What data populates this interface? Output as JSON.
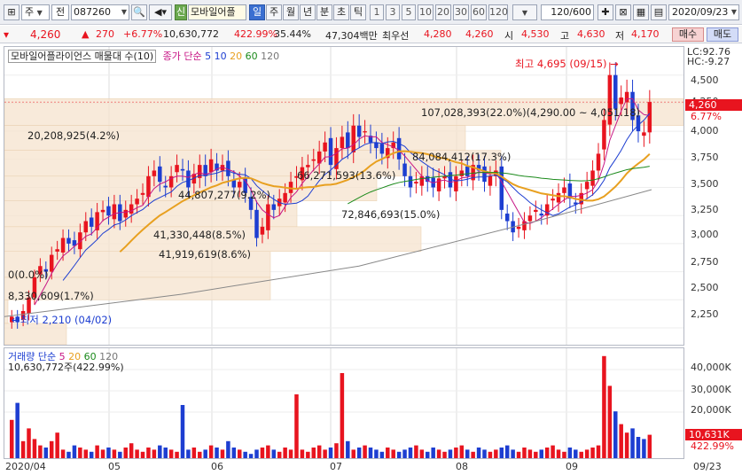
{
  "toolbar": {
    "type_select": "주",
    "market_select": "전",
    "stock_code": "087260",
    "credit_badge": "신",
    "stock_name": "모바일어플",
    "periods": [
      "일",
      "주",
      "월",
      "년",
      "분",
      "초",
      "틱"
    ],
    "selected_period": "일",
    "intervals": [
      "1",
      "3",
      "5",
      "10",
      "20",
      "30",
      "60",
      "120"
    ],
    "count_display": "120",
    "count_total": "/600",
    "date_value": "2020/09/23"
  },
  "quote": {
    "price": "4,260",
    "change": "270",
    "change_rate": "+6.77%",
    "volume": "10,630,772",
    "volume_rate": "422.99%",
    "turnover": "35.44%",
    "amount": "47,304백만",
    "best_ask_label": "최우선",
    "best_ask": "4,280",
    "best_bid": "4,260",
    "open_label": "시",
    "open": "4,530",
    "high_label": "고",
    "high": "4,630",
    "low_label": "저",
    "low": "4,170",
    "buy_button": "매수",
    "sell_button": "매도"
  },
  "chart": {
    "title": "모바일어플라이언스 매물대 수(10)",
    "legend_main": {
      "close_label": "종가 단순",
      "ma": [
        "5",
        "10",
        "20",
        "60",
        "120"
      ],
      "colors": [
        "#1d3ed1",
        "#e8a020",
        "#1b8a1b",
        "#777777"
      ]
    },
    "legend_volume": {
      "label": "거래량 단순",
      "ma": [
        "5",
        "20",
        "60",
        "120"
      ]
    },
    "volume_value": "10,630,772주(422.99%)",
    "lc": "LC:92.76",
    "hc": "HC:-9.27",
    "high_marker": "최고 4,695 (09/15)",
    "low_marker": "최저 2,210 (04/02)",
    "price_tag": "4,260",
    "rate_tag": "6.77%",
    "vol_tag": "10,631K",
    "vol_rate_tag": "422.99%",
    "volume_profile": [
      "107,028,393(22.0%)(4,290.00 ~ 4,051.18)",
      "20,208,925(4.2%)",
      "84,084,412(17.3%)",
      "66,271,593(13.6%)",
      "44,807,277(9.2%)",
      "72,846,693(15.0%)",
      "41,330,448(8.5%)",
      "41,919,619(8.6%)",
      "0(0.0%)",
      "8,330,609(1.7%)"
    ],
    "y_ticks": [
      "4,500",
      "4,250",
      "4,000",
      "3,750",
      "3,500",
      "3,250",
      "3,000",
      "2,750",
      "2,500",
      "2,250"
    ],
    "vol_ticks": [
      "40,000K",
      "30,000K",
      "20,000K"
    ],
    "x_ticks": [
      "2020/04",
      "05",
      "06",
      "07",
      "08",
      "09",
      "09/23"
    ]
  },
  "chart_data": {
    "type": "candlestick",
    "title": "모바일어플라이언스 매물대 수(10)",
    "y_range": [
      2100,
      4750
    ],
    "x_range": [
      "2020/04/01",
      "2020/09/23"
    ],
    "high": {
      "value": 4695,
      "date": "09/15"
    },
    "low": {
      "value": 2210,
      "date": "04/02"
    },
    "last_close": 4260,
    "volume_profile": [
      {
        "volume": 107028393,
        "pct": 22.0,
        "range": [
          4051.18,
          4290.0
        ]
      },
      {
        "volume": 20208925,
        "pct": 4.2
      },
      {
        "volume": 84084412,
        "pct": 17.3
      },
      {
        "volume": 66271593,
        "pct": 13.6
      },
      {
        "volume": 44807277,
        "pct": 9.2
      },
      {
        "volume": 72846693,
        "pct": 15.0
      },
      {
        "volume": 41330448,
        "pct": 8.5
      },
      {
        "volume": 41919619,
        "pct": 8.6
      },
      {
        "volume": 0,
        "pct": 0.0
      },
      {
        "volume": 8330609,
        "pct": 1.7
      }
    ],
    "moving_averages": [
      5,
      10,
      20,
      60,
      120
    ],
    "last_volume": 10630772
  }
}
